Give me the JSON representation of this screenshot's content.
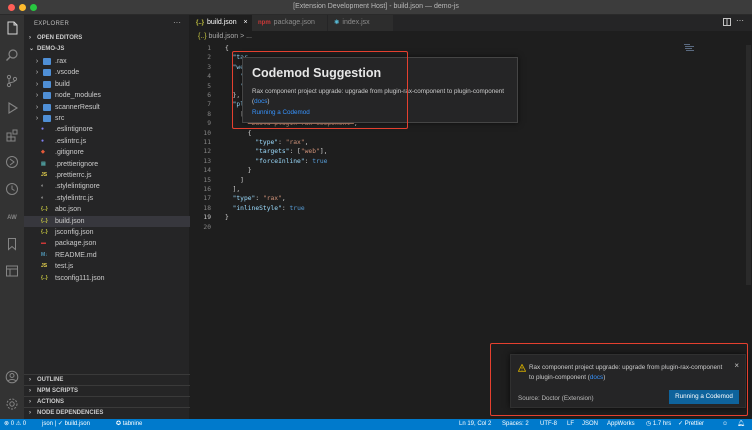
{
  "window": {
    "title": "[Extension Development Host] - build.json — demo-js",
    "traffic_colors": [
      "#ff5f57",
      "#febc2e",
      "#28c840"
    ]
  },
  "activity_bar": {
    "icons": [
      "files-icon",
      "search-icon",
      "source-control-icon",
      "run-debug-icon",
      "extensions-icon",
      "timeline-icon",
      "history-icon",
      "aw-icon",
      "bookmark-icon",
      "panel-icon",
      "account-icon",
      "settings-gear-icon"
    ],
    "aw_label": "AW"
  },
  "sidebar": {
    "header": "EXPLORER",
    "more": "···",
    "open_editors": "OPEN EDITORS",
    "project": "DEMO-JS",
    "items": [
      {
        "label": ".rax",
        "kind": "folder"
      },
      {
        "label": ".vscode",
        "kind": "folder"
      },
      {
        "label": "build",
        "kind": "folder"
      },
      {
        "label": "node_modules",
        "kind": "folder"
      },
      {
        "label": "scannerResult",
        "kind": "folder"
      },
      {
        "label": "src",
        "kind": "folder"
      },
      {
        "label": ".eslintignore",
        "kind": "eslint"
      },
      {
        "label": ".eslintrc.js",
        "kind": "eslint"
      },
      {
        "label": ".gitignore",
        "kind": "git"
      },
      {
        "label": ".prettierignore",
        "kind": "prettier"
      },
      {
        "label": ".prettierrc.js",
        "kind": "js"
      },
      {
        "label": ".stylelintignore",
        "kind": "stylelint"
      },
      {
        "label": ".stylelintrc.js",
        "kind": "stylelint"
      },
      {
        "label": "abc.json",
        "kind": "json"
      },
      {
        "label": "build.json",
        "kind": "json"
      },
      {
        "label": "jsconfig.json",
        "kind": "json"
      },
      {
        "label": "package.json",
        "kind": "npm"
      },
      {
        "label": "README.md",
        "kind": "md"
      },
      {
        "label": "test.js",
        "kind": "js"
      },
      {
        "label": "tsconfig111.json",
        "kind": "json"
      }
    ],
    "selected_index": 14,
    "panels": [
      "OUTLINE",
      "NPM SCRIPTS",
      "ACTIONS",
      "NODE DEPENDENCIES"
    ]
  },
  "tabs": [
    {
      "icon": "{..}",
      "label": "build.json",
      "close": "×"
    },
    {
      "icon": "npm",
      "label": "package.json"
    },
    {
      "icon": "⚛",
      "label": "index.jsx"
    }
  ],
  "breadcrumb": {
    "icon": "{..}",
    "file": "build.json",
    "sep": ">",
    "rest": "..."
  },
  "code": {
    "current_line": 19,
    "lines": [
      {
        "n": "1",
        "parts": [
          {
            "c": "p",
            "t": "{"
          }
        ]
      },
      {
        "n": "2",
        "parts": [
          {
            "c": "p",
            "t": "  "
          },
          {
            "c": "k",
            "t": "\"tar"
          }
        ]
      },
      {
        "n": "3",
        "parts": [
          {
            "c": "p",
            "t": "  "
          },
          {
            "c": "k",
            "t": "\"web"
          }
        ]
      },
      {
        "n": "4",
        "parts": [
          {
            "c": "p",
            "t": "    "
          },
          {
            "c": "k",
            "t": "\"m"
          }
        ]
      },
      {
        "n": "5",
        "parts": [
          {
            "c": "p",
            "t": "    "
          },
          {
            "c": "k",
            "t": "\"p"
          }
        ]
      },
      {
        "n": "6",
        "parts": [
          {
            "c": "p",
            "t": "  },"
          }
        ]
      },
      {
        "n": "7",
        "parts": [
          {
            "c": "p",
            "t": "  "
          },
          {
            "c": "k",
            "t": "\"plu"
          }
        ]
      },
      {
        "n": "8",
        "parts": [
          {
            "c": "p",
            "t": "    ["
          }
        ]
      },
      {
        "n": "9",
        "parts": [
          {
            "c": "p",
            "t": "      "
          },
          {
            "c": "strike",
            "t": "\"build-plugin-rax-component\""
          },
          {
            "c": "p",
            "t": ","
          }
        ]
      },
      {
        "n": "10",
        "parts": [
          {
            "c": "p",
            "t": "      {"
          }
        ]
      },
      {
        "n": "11",
        "parts": [
          {
            "c": "p",
            "t": "        "
          },
          {
            "c": "k",
            "t": "\"type\""
          },
          {
            "c": "p",
            "t": ": "
          },
          {
            "c": "s",
            "t": "\"rax\""
          },
          {
            "c": "p",
            "t": ","
          }
        ]
      },
      {
        "n": "12",
        "parts": [
          {
            "c": "p",
            "t": "        "
          },
          {
            "c": "k",
            "t": "\"targets\""
          },
          {
            "c": "p",
            "t": ": ["
          },
          {
            "c": "s",
            "t": "\"web\""
          },
          {
            "c": "p",
            "t": "],"
          }
        ]
      },
      {
        "n": "13",
        "parts": [
          {
            "c": "p",
            "t": "        "
          },
          {
            "c": "k",
            "t": "\"forceInline\""
          },
          {
            "c": "p",
            "t": ": "
          },
          {
            "c": "b",
            "t": "true"
          }
        ]
      },
      {
        "n": "14",
        "parts": [
          {
            "c": "p",
            "t": "      }"
          }
        ]
      },
      {
        "n": "15",
        "parts": [
          {
            "c": "p",
            "t": "    ]"
          }
        ]
      },
      {
        "n": "16",
        "parts": [
          {
            "c": "p",
            "t": "  ],"
          }
        ]
      },
      {
        "n": "17",
        "parts": [
          {
            "c": "p",
            "t": "  "
          },
          {
            "c": "k",
            "t": "\"type\""
          },
          {
            "c": "p",
            "t": ": "
          },
          {
            "c": "s",
            "t": "\"rax\""
          },
          {
            "c": "p",
            "t": ","
          }
        ]
      },
      {
        "n": "18",
        "parts": [
          {
            "c": "p",
            "t": "  "
          },
          {
            "c": "k",
            "t": "\"inlineStyle\""
          },
          {
            "c": "p",
            "t": ": "
          },
          {
            "c": "b",
            "t": "true"
          }
        ]
      },
      {
        "n": "19",
        "parts": [
          {
            "c": "p",
            "t": "}"
          }
        ]
      },
      {
        "n": "20",
        "parts": []
      }
    ]
  },
  "suggestion": {
    "title": "Codemod Suggestion",
    "text_before": "Rax component project upgrade: upgrade from plugin-rax-component to plugin-component (",
    "link": "docs",
    "text_after": ")",
    "action": "Running a Codemod"
  },
  "notification": {
    "text_before": "Rax component project upgrade: upgrade from plugin-rax-component to plugin-component (",
    "link": "docs",
    "text_after": ")",
    "close": "×",
    "source": "Source: Doctor (Extension)",
    "button": "Running a Codemod"
  },
  "statusbar": {
    "errors": "0",
    "warnings": "0",
    "language_path": "json | ✓ build.json",
    "tabnine": "tabnine",
    "position": "Ln 19, Col 2",
    "spaces": "Spaces: 2",
    "encoding": "UTF-8",
    "eol": "LF",
    "language": "JSON",
    "appworks": "AppWorks",
    "time": "1.7 hrs",
    "prettier": "✓ Prettier",
    "colors": {
      "bar": "#007acc"
    }
  },
  "highlight_color": "#e5402f"
}
